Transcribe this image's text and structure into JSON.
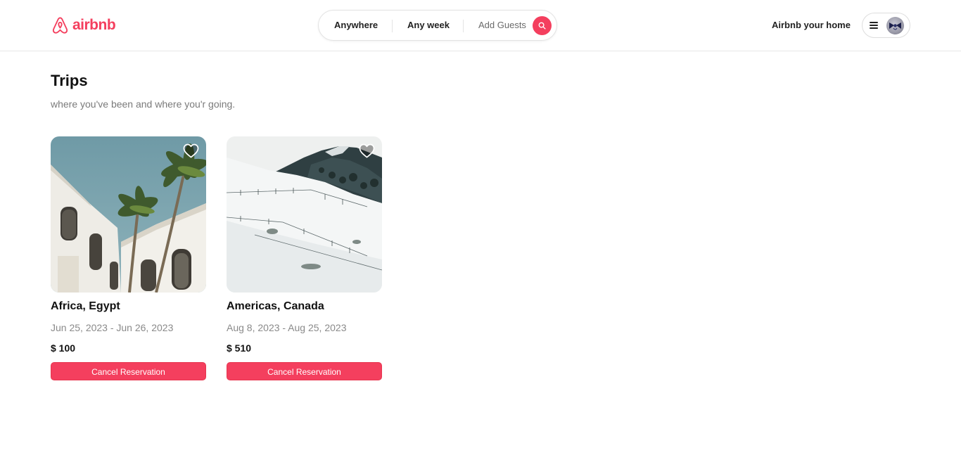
{
  "brand": {
    "name": "airbnb",
    "color": "#f43f5e"
  },
  "search": {
    "location_label": "Anywhere",
    "date_label": "Any week",
    "guests_label": "Add Guests",
    "icon": "search-icon"
  },
  "header": {
    "host_link": "Airbnb your home",
    "menu_icon": "hamburger-icon",
    "avatar_icon": "avatar"
  },
  "trips": {
    "title": "Trips",
    "subtitle": "where you've been and where you'r going.",
    "items": [
      {
        "location": "Africa, Egypt",
        "dates": "Jun 25, 2023 - Jun 26, 2023",
        "price": "$ 100",
        "action": "Cancel Reservation",
        "image": "white-building-with-palm-trees",
        "favorite_icon": "heart-icon"
      },
      {
        "location": "Americas, Canada",
        "dates": "Aug 8, 2023 - Aug 25, 2023",
        "price": "$ 510",
        "action": "Cancel Reservation",
        "image": "snowy-hillside-with-mountain",
        "favorite_icon": "heart-icon"
      }
    ]
  }
}
